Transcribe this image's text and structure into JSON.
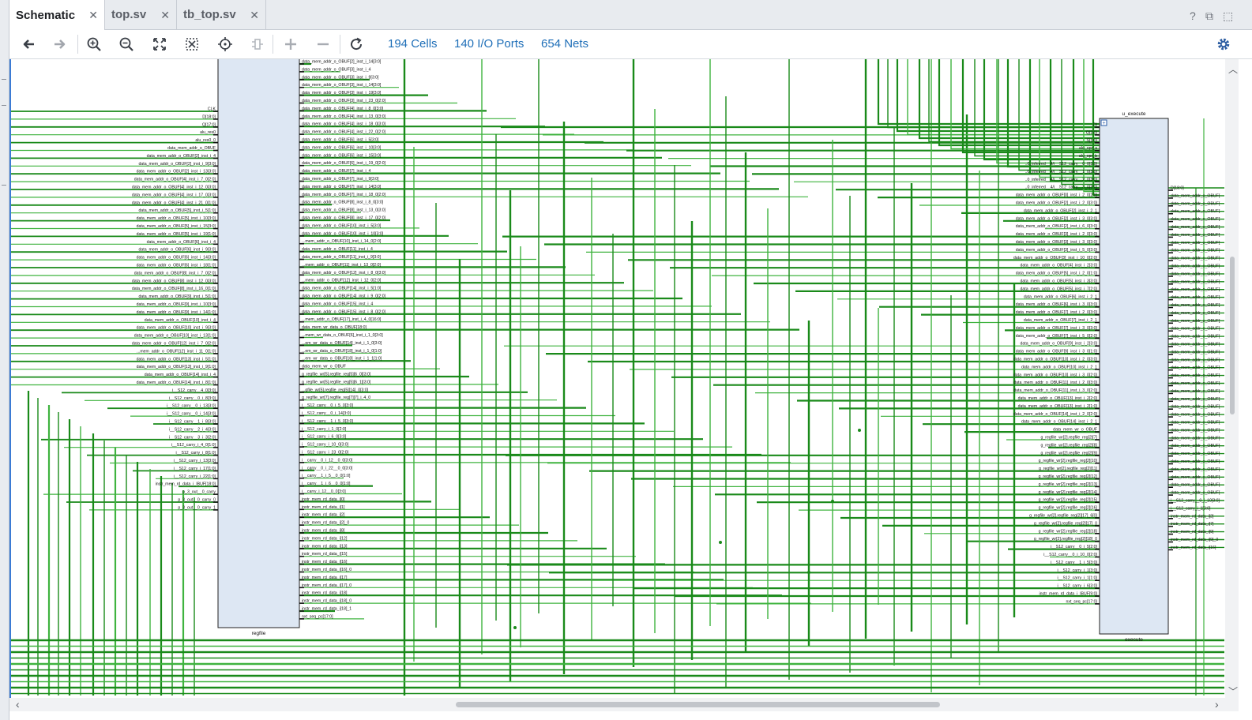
{
  "tabs": [
    {
      "label": "Schematic",
      "active": true
    },
    {
      "label": "top.sv",
      "active": false
    },
    {
      "label": "tb_top.sv",
      "active": false
    }
  ],
  "window_controls": {
    "help": "?",
    "restore": "⧉",
    "maximize": "⬚"
  },
  "toolbar": {
    "icons": [
      "back-arrow-icon",
      "forward-arrow-icon",
      "zoom-in-icon",
      "zoom-out-icon",
      "fit-view-icon",
      "zoom-selection-icon",
      "locate-icon",
      "route-icon",
      "add-icon",
      "remove-icon",
      "refresh-icon"
    ],
    "stats": {
      "cells": "194 Cells",
      "ports": "140 I/O Ports",
      "nets": "654 Nets"
    },
    "settings_icon": "gear-icon"
  },
  "colors": {
    "wire": "#1a8a1a",
    "wire_light": "#3fb33f",
    "block_fill": "#dde7f3",
    "block_stroke": "#222222",
    "accent": "#1f6fb8"
  },
  "schematic": {
    "regfile": {
      "name": "regfile",
      "left_pins": [
        "CLK",
        "D[18:0]",
        "Q[17:0]",
        "alu_res0",
        "alu_res0_0",
        "data_mem_addr_o_OBUF",
        "data_mem_addr_o_OBUF[2]_inst_i_4",
        "data_mem_addr_o_OBUF[2]_inst_i_9[3:0]",
        "data_mem_addr_o_OBUF[2]_inst_i_13[3:0]",
        "data_mem_addr_o_OBUF[4]_inst_i_7_0[2:0]",
        "data_mem_addr_o_OBUF[4]_inst_i_12_0[3:0]",
        "data_mem_addr_o_OBUF[4]_inst_i_17_0[3:0]",
        "data_mem_addr_o_OBUF[4]_inst_i_21_0[1:0]",
        "data_mem_addr_o_OBUF[5]_inst_i_5[1:0]",
        "data_mem_addr_o_OBUF[5]_inst_i_10[3:0]",
        "data_mem_addr_o_OBUF[5]_inst_i_15[3:0]",
        "data_mem_addr_o_OBUF[5]_inst_i_19[1:0]",
        "data_mem_addr_o_OBUF[6]_inst_i_4",
        "data_mem_addr_o_OBUF[6]_inst_i_9[3:0]",
        "data_mem_addr_o_OBUF[6]_inst_i_14[3:0]",
        "data_mem_addr_o_OBUF[6]_inst_i_18[1:0]",
        "data_mem_addr_o_OBUF[8]_inst_i_7_0[2:0]",
        "data_mem_addr_o_OBUF[8]_inst_i_12_0[3:0]",
        "data_mem_addr_o_OBUF[8]_inst_i_16_0[1:0]",
        "data_mem_addr_o_OBUF[9]_inst_i_5[1:0]",
        "data_mem_addr_o_OBUF[9]_inst_i_10[3:0]",
        "data_mem_addr_o_OBUF[9]_inst_i_14[1:0]",
        "data_mem_addr_o_OBUF[10]_inst_i_4",
        "data_mem_addr_o_OBUF[10]_inst_i_9[3:0]",
        "data_mem_addr_o_OBUF[10]_inst_i_13[1:0]",
        "data_mem_addr_o_OBUF[12]_inst_i_7_0[2:0]",
        "...mem_addr_o_OBUF[12]_inst_i_11_0[1:0]",
        "data_mem_addr_o_OBUF[13]_inst_i_5[1:0]",
        "data_mem_addr_o_OBUF[13]_inst_i_9[1:0]",
        "data_mem_addr_o_OBUF[14]_inst_i_4",
        "data_mem_addr_o_OBUF[14]_inst_i_8[1:0]",
        "i__S12_carry__4_0[3:0]",
        "i__S12_carry__0_i_8[3:0]",
        "i__S12_carry__0_i_13[3:0]",
        "i__S12_carry__0_i_14[3:0]",
        "i__S12_carry__1_i_8[3:0]",
        "i__S12_carry__2_i_4[3:0]",
        "i__S12_carry__3_i_3[2:0]",
        "i__S12_carry_i_4_0[1:0]",
        "i__S12_carry_i_8[1:0]",
        "i__S12_carry_i_13[3:0]",
        "i__S12_carry_i_17[1:0]",
        "i__S12_carry_i_22[1:0]",
        "instr_mem_rd_data_i_IBUF[18:0]",
        "p_3_out__0_carry",
        "p_3_out__0_carry_0",
        "p_3_out__0_carry_1"
      ],
      "right_pins": [
        "data_mem_addr_o_OBUF[2]_inst_i_14[3:0]",
        "data_mem_addr_o_OBUF[3]_inst_i_4",
        "data_mem_addr_o_OBUF[3]_inst_i_9[3:0]",
        "data_mem_addr_o_OBUF[3]_inst_i_14[3:0]",
        "data_mem_addr_o_OBUF[3]_inst_i_19[3:0]",
        "data_mem_addr_o_OBUF[3]_inst_i_23_0[2:0]",
        "data_mem_addr_o_OBUF[4]_inst_i_8_0[3:0]",
        "data_mem_addr_o_OBUF[4]_inst_i_13_0[3:0]",
        "data_mem_addr_o_OBUF[4]_inst_i_18_0[3:0]",
        "data_mem_addr_o_OBUF[4]_inst_i_22_0[2:0]",
        "data_mem_addr_o_OBUF[6]_inst_i_5[3:0]",
        "data_mem_addr_o_OBUF[6]_inst_i_10[3:0]",
        "data_mem_addr_o_OBUF[6]_inst_i_15[3:0]",
        "data_mem_addr_o_OBUF[6]_inst_i_19_0[2:0]",
        "data_mem_addr_o_OBUF[7]_inst_i_4",
        "data_mem_addr_o_OBUF[7]_inst_i_9[3:0]",
        "data_mem_addr_o_OBUF[7]_inst_i_14[3:0]",
        "data_mem_addr_o_OBUF[7]_inst_i_18_0[2:0]",
        "data_mem_addr_o_OBUF[8]_inst_i_8_0[3:0]",
        "data_mem_addr_o_OBUF[8]_inst_i_13_0[3:0]",
        "data_mem_addr_o_OBUF[8]_inst_i_17_0[2:0]",
        "data_mem_addr_o_OBUF[10]_inst_i_5[3:0]",
        "data_mem_addr_o_OBUF[10]_inst_i_10[3:0]",
        "...mem_addr_o_OBUF[10]_inst_i_14_0[2:0]",
        "data_mem_addr_o_OBUF[11]_inst_i_4",
        "data_mem_addr_o_OBUF[11]_inst_i_9[3:0]",
        "...mem_addr_o_OBUF[11]_inst_i_13_0[2:0]",
        "data_mem_addr_o_OBUF[12]_inst_i_8_0[3:0]",
        "...mem_addr_o_OBUF[12]_inst_i_12_0[2:0]",
        "data_mem_addr_o_OBUF[14]_inst_i_5[1:0]",
        "data_mem_addr_o_OBUF[14]_inst_i_9_0[2:0]",
        "data_mem_addr_o_OBUF[15]_inst_i_4",
        "data_mem_addr_o_OBUF[15]_inst_i_8_0[2:0]",
        "...mem_addr_o_OBUF[17]_inst_i_4_0[16:0]",
        "data_mem_wr_data_o_OBUF[18:0]",
        "...mem_wr_data_o_OBUF[6]_inst_i_1_0[3:0]",
        "...em_wr_data_o_OBUF[14]_inst_i_1_0[3:0]",
        "...em_wr_data_o_OBUF[18]_inst_i_1_0[1:0]",
        "...em_wr_data_o_OBUF[18]_inst_i_1_1[1:0]",
        "data_mem_wr_o_OBUF",
        "g_regfile_wr[5].regfile_reg[5][6_0][3:0]",
        "g_regfile_wr[5].regfile_reg[5][6_1][3:0]",
        "...gfile_wr[5].regfile_reg[5][14]_0[3:0]",
        "g_regfile_wr[7].regfile_reg[7][7]_i_4_0",
        "i__S12_carry__0_i_5_0[3:0]",
        "i__S12_carry__0_i_14[3:0]",
        "i__S12_carry__1_i_5_0[3:0]",
        "i__S12_carry_i_1_0[2:0]",
        "i__S12_carry_i_6_0[3:0]",
        "i__S12_carry_i_10_0[3:0]",
        "i__S12_carry_i_23_0[2:0]",
        "i__carry__0_i_12__0_0[3:0]",
        "i__carry__0_i_22__0_0[3:0]",
        "i__carry__1_i_5__0_0[1:0]",
        "i__carry__1_i_6__0_0[1:0]",
        "i__carry_i_12__0_0[3:0]",
        "instr_mem_rd_data_i[0]",
        "instr_mem_rd_data_i[1]",
        "instr_mem_rd_data_i[2]",
        "instr_mem_rd_data_i[2]_0",
        "instr_mem_rd_data_i[8]",
        "instr_mem_rd_data_i[12]",
        "instr_mem_rd_data_i[13]",
        "instr_mem_rd_data_i[15]",
        "instr_mem_rd_data_i[16]",
        "instr_mem_rd_data_i[16]_0",
        "instr_mem_rd_data_i[17]",
        "instr_mem_rd_data_i[17]_0",
        "instr_mem_rd_data_i[18]",
        "instr_mem_rd_data_i[18]_0",
        "instr_mem_rd_data_i[18]_1",
        "nxt_seq_pc[17:0]"
      ]
    },
    "execute": {
      "instance": "u_execute",
      "name": "execute",
      "left_pins": [
        "DI",
        "Q[2:0]",
        "S[1:0]",
        "alu_opr_a",
        "alu_opr_b",
        "..0_inferred__4/i__S12_carry__0_0[3:0]",
        "..0_inferred__4/i__S12_carry__1_0[3:0]",
        "..0_inferred__4/i__S12_carry__2_0[3:0]",
        "..0_inferred__4/i__S12_carry__3_0[3:0]",
        "data_mem_addr_o_OBUF[0]_inst_i_2_0[2:0]",
        "data_mem_addr_o_OBUF[2]_inst_i_2_0[3:0]",
        "data_mem_addr_o_OBUF[2]_inst_i_2_1",
        "data_mem_addr_o_OBUF[2]_inst_i_3_0[3:0]",
        "data_mem_addr_o_OBUF[2]_inst_i_6_0[3:0]",
        "data_mem_addr_o_OBUF[3]_inst_i_2_0[3:0]",
        "data_mem_addr_o_OBUF[3]_inst_i_3_0[3:0]",
        "data_mem_addr_o_OBUF[3]_inst_i_5_0[3:0]",
        "data_mem_addr_o_OBUF[3]_inst_i_10_0[2:0]",
        "data_mem_addr_o_OBUF[4]_inst_i_2[3:0]",
        "data_mem_addr_o_OBUF[5]_inst_i_2_0[1:0]",
        "data_mem_addr_o_OBUF[5]_inst_i_3[3:0]",
        "data_mem_addr_o_OBUF[5]_inst_i_7[2:0]",
        "data_mem_addr_o_OBUF[6]_inst_i_2_1",
        "data_mem_addr_o_OBUF[6]_inst_i_3_0[3:0]",
        "data_mem_addr_o_OBUF[7]_inst_i_2_0[3:0]",
        "data_mem_addr_o_OBUF[7]_inst_i_2_1",
        "data_mem_addr_o_OBUF[7]_inst_i_3_0[3:0]",
        "data_mem_addr_o_OBUF[7]_inst_i_5_0[2:0]",
        "data_mem_addr_o_OBUF[9]_inst_i_2[3:0]",
        "data_mem_addr_o_OBUF[9]_inst_i_3_0[1:0]",
        "data_mem_addr_o_OBUF[10]_inst_i_2_0[3:0]",
        "data_mem_addr_o_OBUF[10]_inst_i_2_1",
        "data_mem_addr_o_OBUF[10]_inst_i_3_0[2:0]",
        "data_mem_addr_o_OBUF[11]_inst_i_2_0[3:0]",
        "data_mem_addr_o_OBUF[11]_inst_i_3_0[2:0]",
        "data_mem_addr_o_OBUF[13]_inst_i_2[2:0]",
        "data_mem_addr_o_OBUF[13]_inst_i_2[1:0]",
        "data_mem_addr_o_OBUF[14]_inst_i_2_0[2:0]",
        "data_mem_addr_o_OBUF[14]_inst_i_2_1",
        "data_mem_wr_o_OBUF",
        "g_regfile_wr[2].regfile_reg[2][7]",
        "g_regfile_wr[2].regfile_reg[2][8]",
        "g_regfile_wr[2].regfile_reg[2][9]",
        "g_regfile_wr[2].regfile_reg[2][10]",
        "g_regfile_wr[2].regfile_reg[2][11]",
        "g_regfile_wr[2].regfile_reg[2][12]",
        "g_regfile_wr[2].regfile_reg[2][13]",
        "g_regfile_wr[2].regfile_reg[2][14]",
        "g_regfile_wr[2].regfile_reg[2][15]",
        "g_regfile_wr[2].regfile_reg[2][16]",
        "g_regfile_wr[2].regfile_reg[2][17]_6[0]",
        "g_regfile_wr[2].regfile_reg[2][17]_0",
        "g_regfile_wr[2].regfile_reg[2][18]",
        "g_regfile_wr[2].regfile_reg[2][18]_0",
        "i__S12_carry__0_i_5[2:0]",
        "i__S12_carry__0_i_10_0[2:0]",
        "i__S12_carry__1_i_5[3:0]",
        "i__S12_carry_i_1[3:0]",
        "i__S12_carry_i_1[1:0]",
        "i__S12_carry_i_6[3:0]",
        "instr_mem_rd_data_i_IBUF[9:0]",
        "nxt_seq_pc[17:0]"
      ],
      "right_pins": [
        "D[18:0]",
        "data_mem_addr_o_OBUF[",
        "data_mem_addr_o_OBUF[",
        "data_mem_addr_o_OBUF[",
        "data_mem_addr_o_OBUF[",
        "data_mem_addr_o_OBUF[",
        "data_mem_addr_o_OBUF[",
        "data_mem_addr_o_OBUF[",
        "data_mem_addr_o_OBUF[",
        "data_mem_addr_o_OBUF[",
        "data_mem_addr_o_OBUF[",
        "data_mem_addr_o_OBUF[",
        "data_mem_addr_o_OBUF[",
        "data_mem_addr_o_OBUF[",
        "data_mem_addr_o_OBUF[",
        "data_mem_addr_o_OBUF[",
        "data_mem_addr_o_OBUF[",
        "data_mem_addr_o_OBUF[",
        "data_mem_addr_o_OBUF[",
        "data_mem_addr_o_OBUF[",
        "data_mem_addr_o_OBUF[",
        "data_mem_addr_o_OBUF[",
        "data_mem_addr_o_OBUF[",
        "data_mem_addr_o_OBUF[",
        "data_mem_addr_o_OBUF[",
        "data_mem_addr_o_OBUF[",
        "data_mem_addr_o_OBUF[",
        "data_mem_addr_o_OBUF[",
        "data_mem_addr_o_OBUF[",
        "data_mem_addr_o_OBUF[",
        "data_mem_addr_o_OBUF[",
        "data_mem_addr_o_OBUF[",
        "data_mem_addr_o_OBUF[",
        "data_mem_addr_o_OBUF[",
        "data_mem_addr_o_OBUF[",
        "data_mem_addr_o_OBUF[",
        "data_mem_addr_o_OBUF[",
        "data_mem_addr_o_OBUF[",
        "data_mem_addr_o_OBUF[",
        "data_mem_addr_o_OBUF[",
        "i__S12_carry__0_i_10[3:0]",
        "i__S12_carry_i_1[3:0]",
        "instr_mem_rd_data_i[2]",
        "instr_mem_rd_data_i[7]",
        "instr_mem_rd_data_i[9]",
        "instr_mem_rd_data_i[9]_0",
        "instr_mem_rd_data_i[16]"
      ]
    }
  }
}
